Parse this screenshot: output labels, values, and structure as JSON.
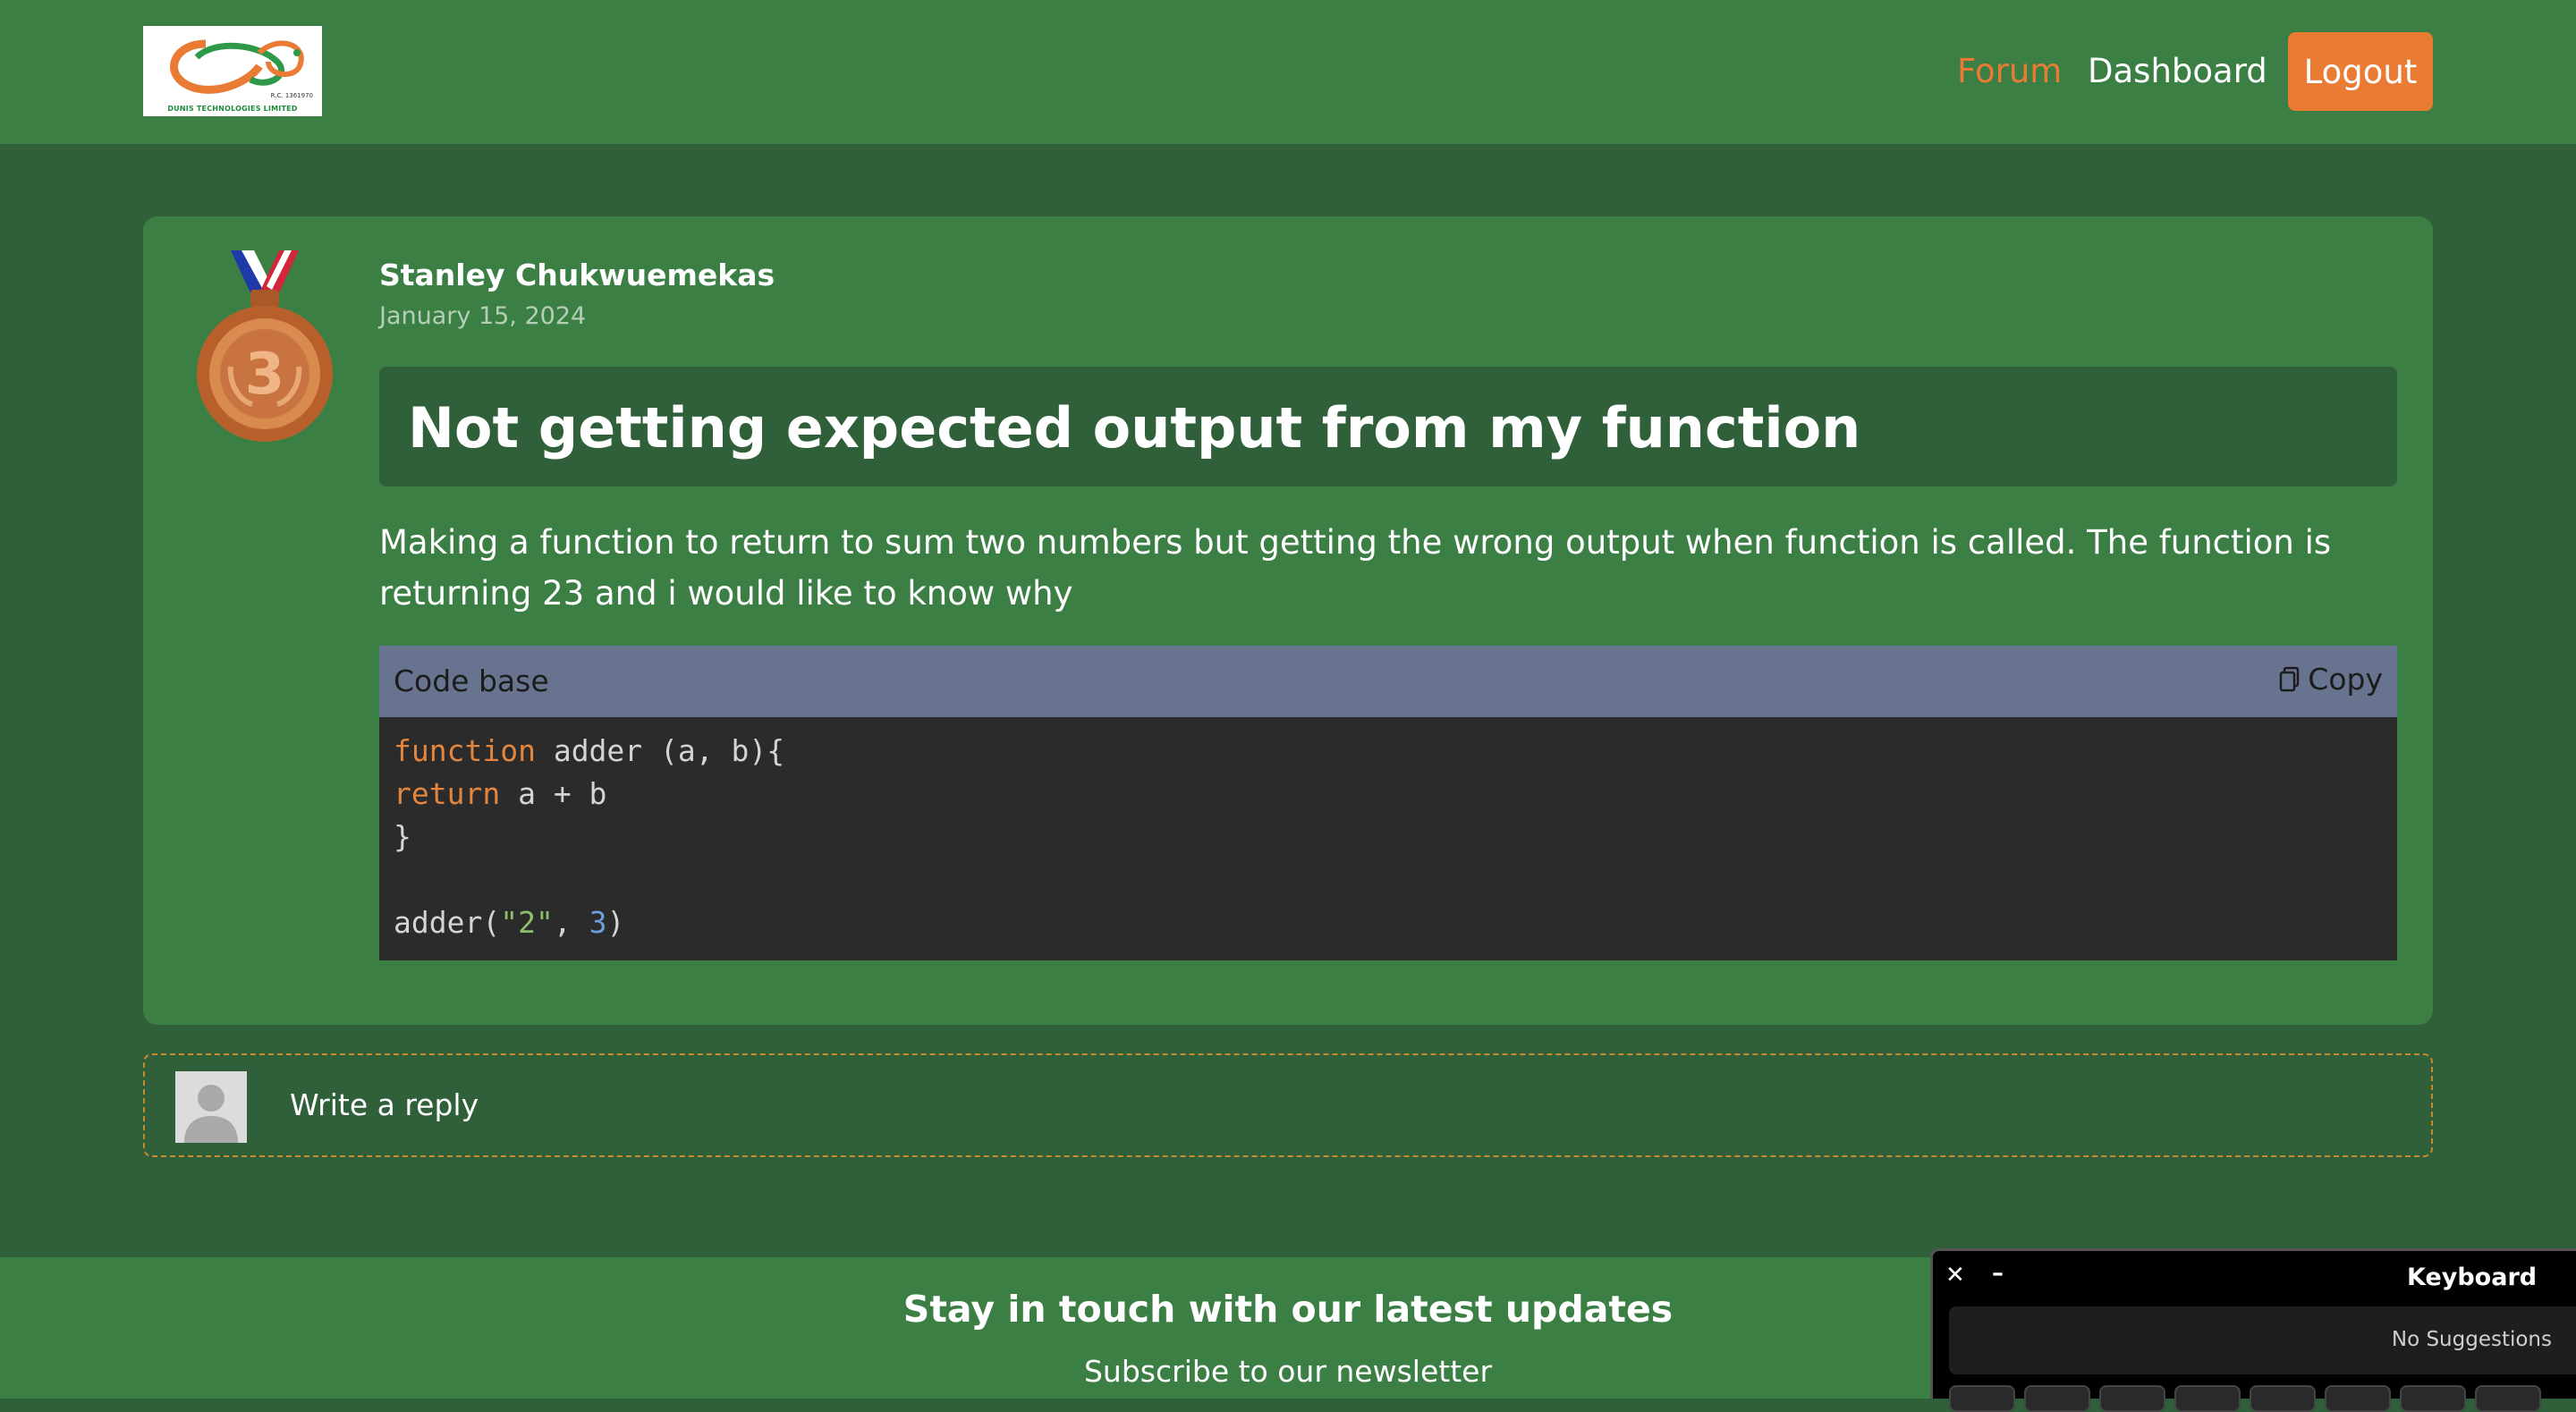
{
  "navbar": {
    "logo_caption": "DUNIS TECHNOLOGIES LIMITED",
    "logo_rc": "R.C. 1361970",
    "links": {
      "forum": "Forum",
      "dashboard": "Dashboard",
      "logout": "Logout"
    }
  },
  "post": {
    "badge_rank": "3",
    "author": "Stanley Chukwuemekas",
    "date": "January 15, 2024",
    "title": "Not getting expected output from my function",
    "body": "Making a function to return to sum two numbers but getting the wrong output when function is called. The function is returning 23 and i would like to know why",
    "code": {
      "label": "Code base",
      "copy_label": "Copy",
      "lines": [
        "function adder (a, b){",
        "return a + b",
        "}",
        "",
        "adder(\"2\", 3)"
      ]
    }
  },
  "reply": {
    "placeholder": "Write a reply"
  },
  "footer": {
    "title": "Stay in touch with our latest updates",
    "subtitle": "Subscribe to our newsletter"
  },
  "keyboard": {
    "close": "✕",
    "minimize": "–",
    "title": "Keyboard",
    "suggestions": "No Suggestions"
  },
  "colors": {
    "page_bg": "#2f603a",
    "surface": "#3b7f45",
    "accent": "#ea7b35",
    "code_header": "#68748f",
    "code_bg": "#2b2b2b"
  },
  "icons": {
    "medal": "bronze-medal-icon",
    "copy": "clipboard-icon",
    "avatar": "user-avatar-icon"
  }
}
